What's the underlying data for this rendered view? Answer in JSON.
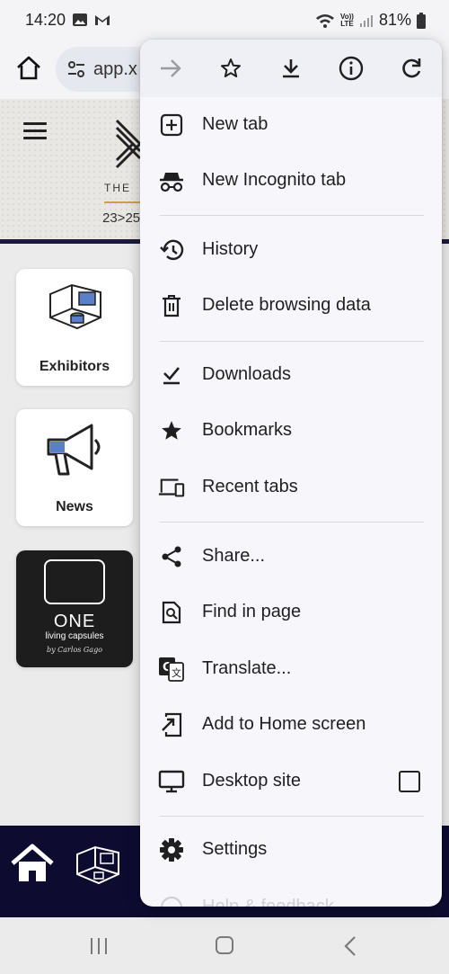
{
  "status_bar": {
    "time": "14:20",
    "lte_top": "Vo))",
    "lte_bottom": "LTE",
    "battery": "81%"
  },
  "toolbar": {
    "url_text": "app.x"
  },
  "page": {
    "hero_the": "THE",
    "hero_date": "23>25",
    "tiles": {
      "exhibitors": "Exhibitors",
      "news": "News",
      "one_title": "ONE",
      "one_sub": "living capsules",
      "one_sig": "by Carlos Gago"
    }
  },
  "menu": {
    "items": {
      "new_tab": "New tab",
      "incognito": "New Incognito tab",
      "history": "History",
      "delete_data": "Delete browsing data",
      "downloads": "Downloads",
      "bookmarks": "Bookmarks",
      "recent_tabs": "Recent tabs",
      "share": "Share...",
      "find": "Find in page",
      "translate": "Translate...",
      "add_home": "Add to Home screen",
      "desktop": "Desktop site",
      "settings": "Settings",
      "help": "Help & feedback"
    }
  },
  "colors": {
    "bottom_nav": "#0d0b30",
    "menu_bg": "#f7f6fb",
    "accent_gold": "#c9a24a",
    "icon_blue": "#5b7fc8"
  }
}
